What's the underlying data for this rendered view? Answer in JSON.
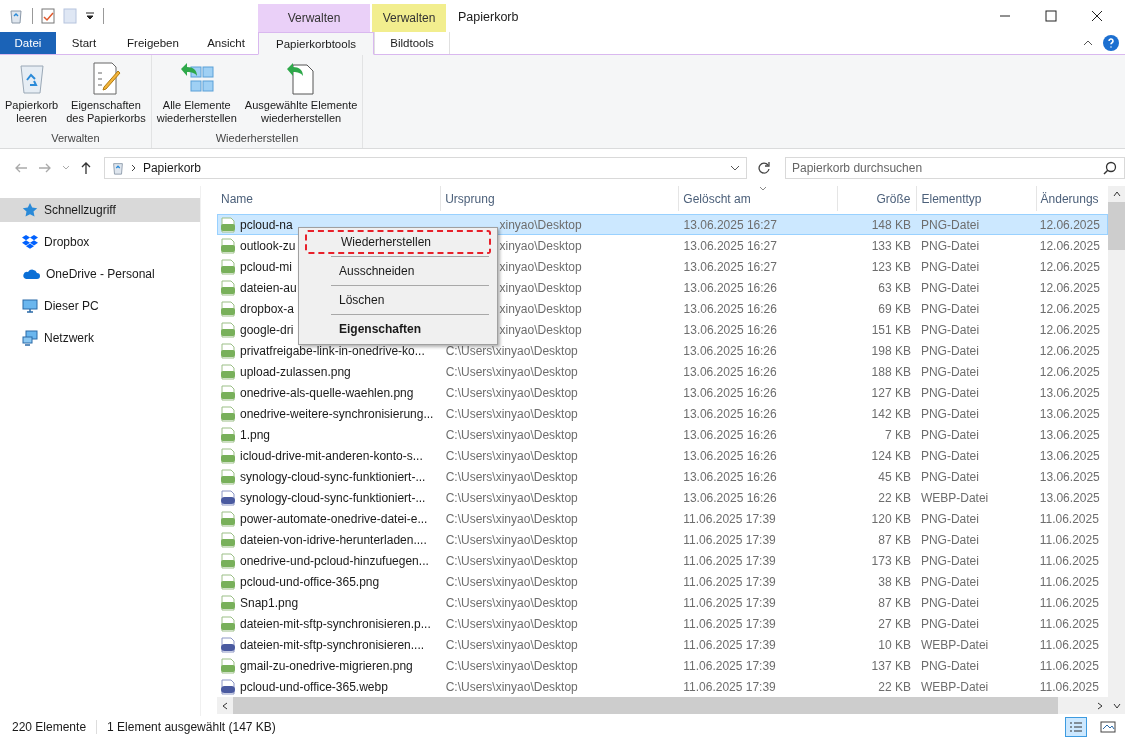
{
  "window": {
    "title": "Papierkorb"
  },
  "context_tabs": [
    {
      "label": "Verwalten",
      "color": "#ead0f8"
    },
    {
      "label": "Verwalten",
      "color": "#f2ee8e"
    }
  ],
  "ribbon_tabs": [
    {
      "label": "Datei",
      "kind": "file",
      "selected": false
    },
    {
      "label": "Start",
      "kind": "tab",
      "selected": false
    },
    {
      "label": "Freigeben",
      "kind": "tab",
      "selected": false
    },
    {
      "label": "Ansicht",
      "kind": "tab",
      "selected": false
    },
    {
      "label": "Papierkorbtools",
      "kind": "tab",
      "selected": true
    },
    {
      "label": "Bildtools",
      "kind": "tab",
      "selected": false
    }
  ],
  "ribbon_groups": [
    {
      "label": "Verwalten",
      "buttons": [
        {
          "label": "Papierkorb\nleeren",
          "kind": "bin"
        },
        {
          "label": "Eigenschaften\ndes Papierkorbs",
          "kind": "props"
        }
      ]
    },
    {
      "label": "Wiederherstellen",
      "buttons": [
        {
          "label": "Alle Elemente\nwiederherstellen",
          "kind": "restore_all"
        },
        {
          "label": "Ausgewählte Elemente\nwiederherstellen",
          "kind": "restore_sel"
        }
      ]
    }
  ],
  "address": {
    "path": "Papierkorb"
  },
  "search": {
    "placeholder": "Papierkorb durchsuchen"
  },
  "sidebar": {
    "items": [
      {
        "label": "Schnellzugriff",
        "kind": "star",
        "selected": true
      },
      {
        "label": "Dropbox",
        "kind": "dropbox",
        "selected": false
      },
      {
        "label": "OneDrive - Personal",
        "kind": "cloud",
        "selected": false
      },
      {
        "label": "Dieser PC",
        "kind": "pc",
        "selected": false
      },
      {
        "label": "Netzwerk",
        "kind": "network",
        "selected": false
      }
    ]
  },
  "table": {
    "columns": [
      "Name",
      "Ursprung",
      "Gelöscht am",
      "Größe",
      "Elementtyp",
      "Änderungs"
    ],
    "rows": [
      {
        "kind": "png",
        "selected": true,
        "covered": true,
        "cells": [
          "pcloud-na",
          "xinyao\\Desktop",
          "13.06.2025 16:27",
          "148 KB",
          "PNG-Datei",
          "12.06.2025"
        ]
      },
      {
        "kind": "png",
        "selected": false,
        "covered": true,
        "cells": [
          "outlook-zu",
          "xinyao\\Desktop",
          "13.06.2025 16:27",
          "133 KB",
          "PNG-Datei",
          "12.06.2025"
        ]
      },
      {
        "kind": "png",
        "selected": false,
        "covered": true,
        "cells": [
          "pcloud-mi",
          "xinyao\\Desktop",
          "13.06.2025 16:27",
          "123 KB",
          "PNG-Datei",
          "12.06.2025"
        ]
      },
      {
        "kind": "png",
        "selected": false,
        "covered": true,
        "cells": [
          "dateien-au",
          "xinyao\\Desktop",
          "13.06.2025 16:26",
          "63 KB",
          "PNG-Datei",
          "12.06.2025"
        ]
      },
      {
        "kind": "png",
        "selected": false,
        "covered": true,
        "cells": [
          "dropbox-a",
          "xinyao\\Desktop",
          "13.06.2025 16:26",
          "69 KB",
          "PNG-Datei",
          "12.06.2025"
        ]
      },
      {
        "kind": "png",
        "selected": false,
        "covered": true,
        "cells": [
          "google-dri",
          "xinyao\\Desktop",
          "13.06.2025 16:26",
          "151 KB",
          "PNG-Datei",
          "12.06.2025"
        ]
      },
      {
        "kind": "png",
        "selected": false,
        "cells": [
          "privatfreigabe-link-in-onedrive-ko...",
          "C:\\Users\\xinyao\\Desktop",
          "13.06.2025 16:26",
          "198 KB",
          "PNG-Datei",
          "12.06.2025"
        ]
      },
      {
        "kind": "png",
        "selected": false,
        "cells": [
          "upload-zulassen.png",
          "C:\\Users\\xinyao\\Desktop",
          "13.06.2025 16:26",
          "188 KB",
          "PNG-Datei",
          "12.06.2025"
        ]
      },
      {
        "kind": "png",
        "selected": false,
        "cells": [
          "onedrive-als-quelle-waehlen.png",
          "C:\\Users\\xinyao\\Desktop",
          "13.06.2025 16:26",
          "127 KB",
          "PNG-Datei",
          "13.06.2025"
        ]
      },
      {
        "kind": "png",
        "selected": false,
        "cells": [
          "onedrive-weitere-synchronisierung...",
          "C:\\Users\\xinyao\\Desktop",
          "13.06.2025 16:26",
          "142 KB",
          "PNG-Datei",
          "13.06.2025"
        ]
      },
      {
        "kind": "png",
        "selected": false,
        "cells": [
          "1.png",
          "C:\\Users\\xinyao\\Desktop",
          "13.06.2025 16:26",
          "7 KB",
          "PNG-Datei",
          "13.06.2025"
        ]
      },
      {
        "kind": "png",
        "selected": false,
        "cells": [
          "icloud-drive-mit-anderen-konto-s...",
          "C:\\Users\\xinyao\\Desktop",
          "13.06.2025 16:26",
          "124 KB",
          "PNG-Datei",
          "13.06.2025"
        ]
      },
      {
        "kind": "png",
        "selected": false,
        "cells": [
          "synology-cloud-sync-funktioniert-...",
          "C:\\Users\\xinyao\\Desktop",
          "13.06.2025 16:26",
          "45 KB",
          "PNG-Datei",
          "13.06.2025"
        ]
      },
      {
        "kind": "webp",
        "selected": false,
        "cells": [
          "synology-cloud-sync-funktioniert-...",
          "C:\\Users\\xinyao\\Desktop",
          "13.06.2025 16:26",
          "22 KB",
          "WEBP-Datei",
          "13.06.2025"
        ]
      },
      {
        "kind": "png",
        "selected": false,
        "cells": [
          "power-automate-onedrive-datei-e...",
          "C:\\Users\\xinyao\\Desktop",
          "11.06.2025 17:39",
          "120 KB",
          "PNG-Datei",
          "11.06.2025"
        ]
      },
      {
        "kind": "png",
        "selected": false,
        "cells": [
          "dateien-von-idrive-herunterladen....",
          "C:\\Users\\xinyao\\Desktop",
          "11.06.2025 17:39",
          "87 KB",
          "PNG-Datei",
          "11.06.2025"
        ]
      },
      {
        "kind": "png",
        "selected": false,
        "cells": [
          "onedrive-und-pcloud-hinzufuegen...",
          "C:\\Users\\xinyao\\Desktop",
          "11.06.2025 17:39",
          "173 KB",
          "PNG-Datei",
          "11.06.2025"
        ]
      },
      {
        "kind": "png",
        "selected": false,
        "cells": [
          "pcloud-und-office-365.png",
          "C:\\Users\\xinyao\\Desktop",
          "11.06.2025 17:39",
          "38 KB",
          "PNG-Datei",
          "11.06.2025"
        ]
      },
      {
        "kind": "png",
        "selected": false,
        "cells": [
          "Snap1.png",
          "C:\\Users\\xinyao\\Desktop",
          "11.06.2025 17:39",
          "87 KB",
          "PNG-Datei",
          "11.06.2025"
        ]
      },
      {
        "kind": "png",
        "selected": false,
        "cells": [
          "dateien-mit-sftp-synchronisieren.p...",
          "C:\\Users\\xinyao\\Desktop",
          "11.06.2025 17:39",
          "27 KB",
          "PNG-Datei",
          "11.06.2025"
        ]
      },
      {
        "kind": "webp",
        "selected": false,
        "cells": [
          "dateien-mit-sftp-synchronisieren....",
          "C:\\Users\\xinyao\\Desktop",
          "11.06.2025 17:39",
          "10 KB",
          "WEBP-Datei",
          "11.06.2025"
        ]
      },
      {
        "kind": "png",
        "selected": false,
        "cells": [
          "gmail-zu-onedrive-migrieren.png",
          "C:\\Users\\xinyao\\Desktop",
          "11.06.2025 17:39",
          "137 KB",
          "PNG-Datei",
          "11.06.2025"
        ]
      },
      {
        "kind": "webp",
        "selected": false,
        "cells": [
          "pcloud-und-office-365.webp",
          "C:\\Users\\xinyao\\Desktop",
          "11.06.2025 17:39",
          "22 KB",
          "WEBP-Datei",
          "11.06.2025"
        ]
      }
    ]
  },
  "context_menu": {
    "items": [
      {
        "label": "Wiederherstellen",
        "highlighted": true,
        "bold": false
      },
      {
        "label": "Ausschneiden",
        "highlighted": false,
        "bold": false
      },
      {
        "label": "Löschen",
        "highlighted": false,
        "bold": false
      },
      {
        "label": "Eigenschaften",
        "highlighted": false,
        "bold": true
      }
    ]
  },
  "status_bar": {
    "count": "220 Elemente",
    "selection": "1 Element ausgewählt (147 KB)"
  }
}
